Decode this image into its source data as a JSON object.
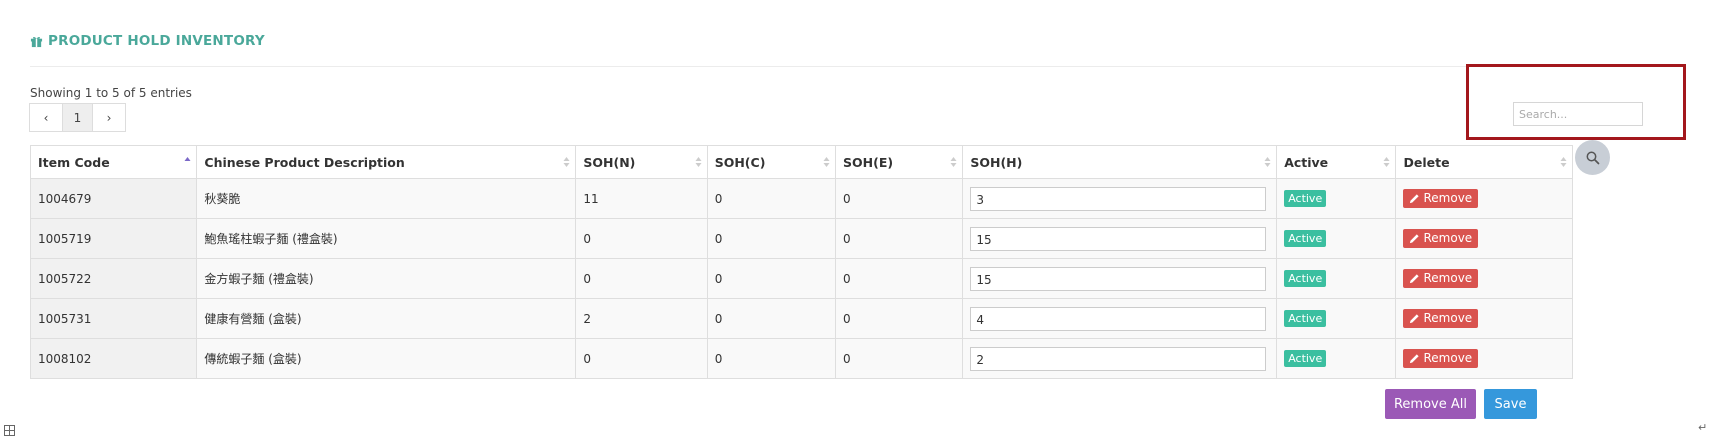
{
  "page": {
    "title": "PRODUCT HOLD INVENTORY",
    "entries_info": "Showing 1 to 5 of 5 entries"
  },
  "pagination": {
    "prev": "‹",
    "current": "1",
    "next": "›"
  },
  "search": {
    "placeholder": "Search..."
  },
  "table": {
    "columns": [
      "Item Code",
      "Chinese Product Description",
      "SOH(N)",
      "SOH(C)",
      "SOH(E)",
      "SOH(H)",
      "Active",
      "Delete"
    ],
    "rows": [
      {
        "item_code": "1004679",
        "description": "秋葵脆",
        "soh_n": "11",
        "soh_c": "0",
        "soh_e": "0",
        "soh_h": "3",
        "active": "Active",
        "delete": "Remove"
      },
      {
        "item_code": "1005719",
        "description": "鮑魚瑤柱蝦子麵 (禮盒裝)",
        "soh_n": "0",
        "soh_c": "0",
        "soh_e": "0",
        "soh_h": "15",
        "active": "Active",
        "delete": "Remove"
      },
      {
        "item_code": "1005722",
        "description": "金方蝦子麵 (禮盒裝)",
        "soh_n": "0",
        "soh_c": "0",
        "soh_e": "0",
        "soh_h": "15",
        "active": "Active",
        "delete": "Remove"
      },
      {
        "item_code": "1005731",
        "description": "健康有營麵 (盒裝)",
        "soh_n": "2",
        "soh_c": "0",
        "soh_e": "0",
        "soh_h": "4",
        "active": "Active",
        "delete": "Remove"
      },
      {
        "item_code": "1008102",
        "description": "傳統蝦子麵 (盒裝)",
        "soh_n": "0",
        "soh_c": "0",
        "soh_e": "0",
        "soh_h": "2",
        "active": "Active",
        "delete": "Remove"
      }
    ]
  },
  "actions": {
    "remove_all": "Remove All",
    "save": "Save"
  },
  "icons": {
    "title_icon": "gift-icon",
    "search_icon": "search-icon",
    "remove_icon": "pencil-icon"
  },
  "colors": {
    "title": "#4aa89a",
    "active_badge": "#3bbfa0",
    "remove_button": "#d9534f",
    "remove_all_button": "#9b59b6",
    "save_button": "#3598dc",
    "highlight_box": "#a3171c"
  }
}
